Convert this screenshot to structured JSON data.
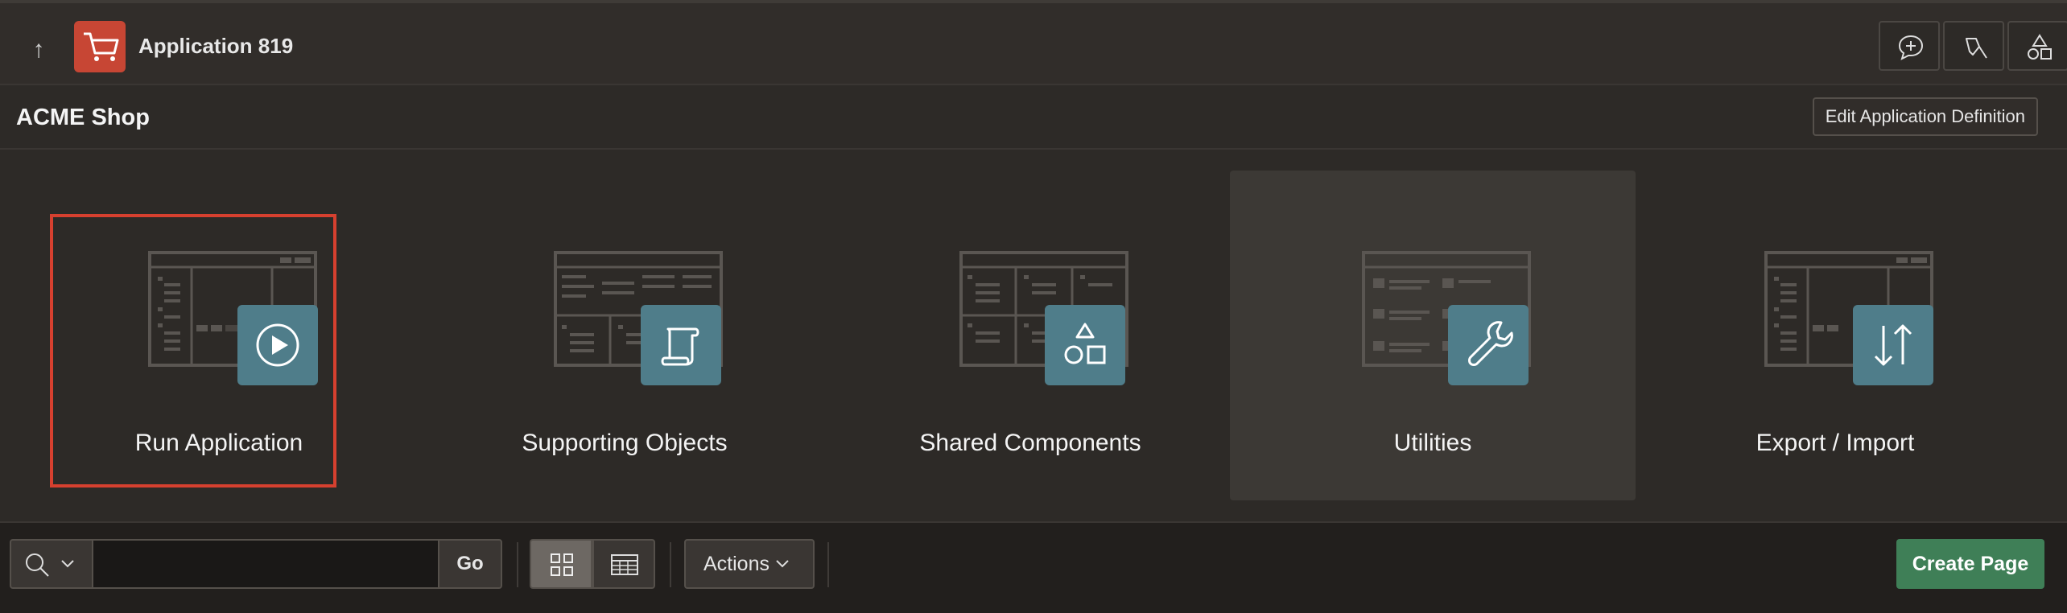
{
  "header": {
    "app_title": "Application 819",
    "up_icon": "arrow-up-icon",
    "logo_icon": "shopping-cart-icon",
    "actions": [
      {
        "name": "feedback-button",
        "icon": "chat-plus-icon"
      },
      {
        "name": "developer-tools-button",
        "icon": "flashlight-icon"
      },
      {
        "name": "shared-components-button",
        "icon": "shapes-icon"
      }
    ]
  },
  "subheader": {
    "page_title": "ACME Shop",
    "edit_button_label": "Edit Application Definition"
  },
  "cards": [
    {
      "label": "Run Application",
      "icon": "play-icon",
      "state": "selected"
    },
    {
      "label": "Supporting Objects",
      "icon": "scroll-icon",
      "state": ""
    },
    {
      "label": "Shared Components",
      "icon": "shapes-icon",
      "state": ""
    },
    {
      "label": "Utilities",
      "icon": "wrench-icon",
      "state": "hover"
    },
    {
      "label": "Export / Import",
      "icon": "arrows-up-down-icon",
      "state": ""
    }
  ],
  "toolbar": {
    "search_value": "",
    "go_label": "Go",
    "actions_label": "Actions",
    "create_page_label": "Create Page",
    "view_modes": [
      "icons-view",
      "report-view"
    ],
    "active_view": "icons-view"
  },
  "colors": {
    "brand_red": "#c74634",
    "tile_teal": "#4f7d8a",
    "primary_green": "#3f7f57",
    "selection_red": "#d6402f"
  }
}
